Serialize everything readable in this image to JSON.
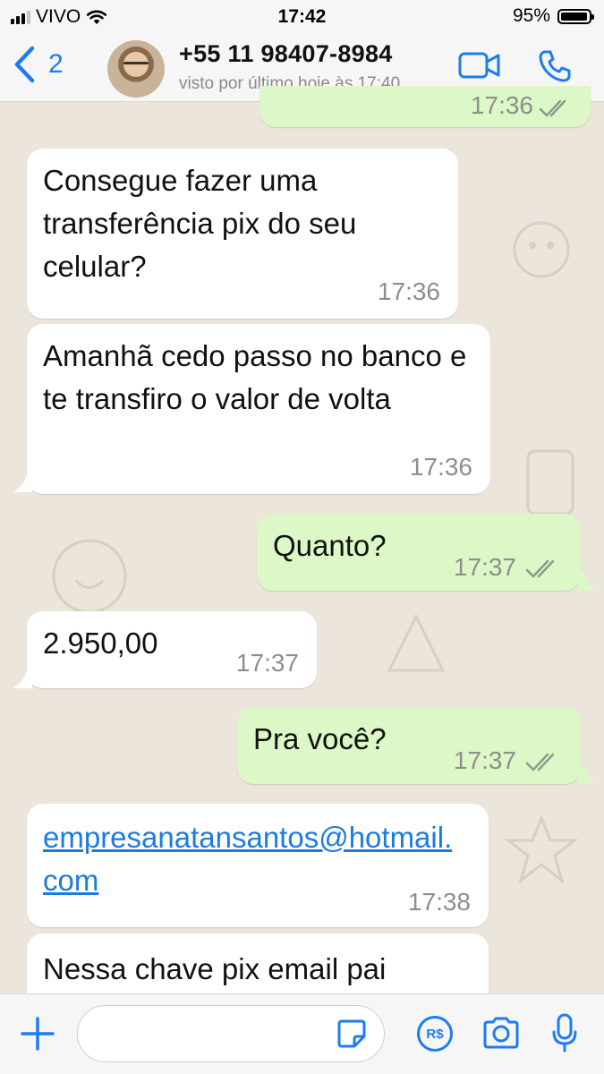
{
  "status_bar": {
    "carrier": "VIVO",
    "time": "17:42",
    "battery": "95%",
    "battery_level": 0.95
  },
  "header": {
    "back_count": "2",
    "contact_name": "+55 11 98407-8984",
    "last_seen": "visto por último hoje às 17:40",
    "icons": [
      "chevron-left-icon",
      "video-camera-icon",
      "phone-icon"
    ]
  },
  "messages": [
    {
      "direction": "out",
      "text": "",
      "time": "17:36",
      "status": "read"
    },
    {
      "direction": "in",
      "text": "Consegue fazer uma transferência pix do seu celular?",
      "time": "17:36"
    },
    {
      "direction": "in",
      "text": "Amanhã cedo passo no banco e te transfiro o valor de volta",
      "time": "17:36"
    },
    {
      "direction": "out",
      "text": "Quanto?",
      "time": "17:37",
      "status": "read"
    },
    {
      "direction": "in",
      "text": "2.950,00",
      "time": "17:37"
    },
    {
      "direction": "out",
      "text": "Pra você?",
      "time": "17:37",
      "status": "read"
    },
    {
      "direction": "in",
      "text": "empresanatansantos@hotmail.com",
      "time": "17:38",
      "is_link": true
    },
    {
      "direction": "in",
      "text": "Nessa chave pix email pai",
      "time": ""
    }
  ],
  "input_bar": {
    "placeholder": "",
    "icons": [
      "plus-icon",
      "sticker-icon",
      "pix-currency-icon",
      "camera-icon",
      "microphone-icon"
    ],
    "pix_label": "R$"
  },
  "colors": {
    "accent": "#1e7cf2",
    "outgoing_bubble": "#dcf8c6",
    "incoming_bubble": "#ffffff",
    "chat_background": "#ebe5dc",
    "link": "#1d7be0",
    "read_ticks": "#8e9a8c"
  }
}
